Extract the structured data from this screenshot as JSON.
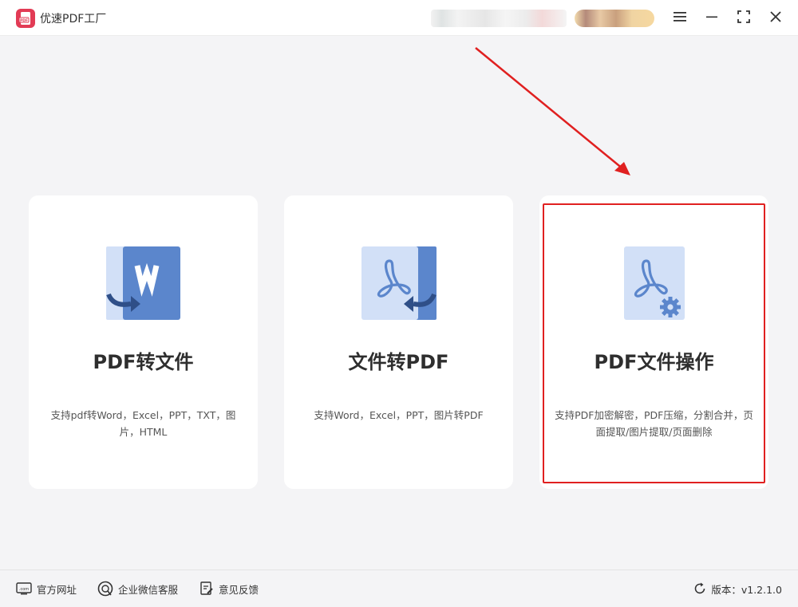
{
  "app": {
    "title": "优速PDF工厂"
  },
  "cards": [
    {
      "title": "PDF转文件",
      "description": "支持pdf转Word，Excel，PPT，TXT，图片，HTML",
      "icon": "pdf-to-word-icon"
    },
    {
      "title": "文件转PDF",
      "description": "支持Word，Excel，PPT，图片转PDF",
      "icon": "file-to-pdf-icon"
    },
    {
      "title": "PDF文件操作",
      "description": "支持PDF加密解密，PDF压缩，分割合并，页面提取/图片提取/页面删除",
      "icon": "pdf-settings-icon"
    }
  ],
  "footer": {
    "website": "官方网址",
    "wechat": "企业微信客服",
    "feedback": "意见反馈",
    "version": "版本：v1.2.1.0"
  },
  "colors": {
    "accent_blue": "#5b86cc",
    "light_blue": "#d2e0f7",
    "highlight_red": "#e02020",
    "logo_red": "#e23b55"
  }
}
